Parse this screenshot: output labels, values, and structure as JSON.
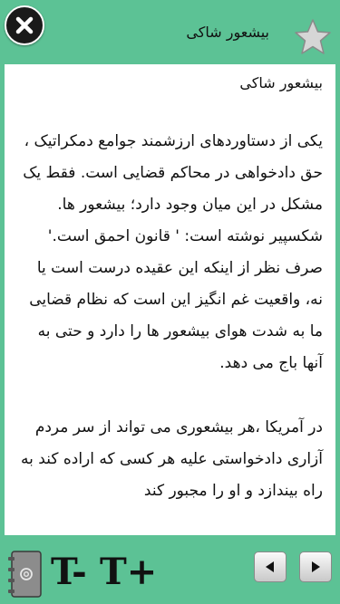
{
  "header": {
    "title": "بیشعور شاکی",
    "close_icon": "close-icon",
    "favorite_icon": "star-icon"
  },
  "content": {
    "title": "بیشعور شاکی",
    "paragraphs": [
      "یکی از دستاوردهای ارزشمند جوامع دمکراتیک ، حق دادخواهی در محاکم قضایی است. فقط یک مشکل در این میان وجود دارد؛ بیشعور ها. شکسپیر نوشته است: ' قانون احمق است.' صرف نظر از اینکه این عقیده درست است یا نه، واقعیت غم انگیز این است که نظام قضایی ما به شدت هوای بیشعور ها را دارد و حتی به آنها باج می دهد.",
      "در آمریکا ،هر بیشعوری می تواند از سر مردم آزاری دادخواستی علیه هر کسی که اراده کند به راه بیندازد و او را مجبور کند"
    ]
  },
  "toolbar": {
    "decrease_label": "T-",
    "increase_label": "T+",
    "book_icon": "address-book-icon",
    "prev_icon": "arrow-left-icon",
    "next_icon": "arrow-right-icon"
  },
  "colors": {
    "background": "#5cc295",
    "page": "#ffffff",
    "text": "#111111"
  }
}
